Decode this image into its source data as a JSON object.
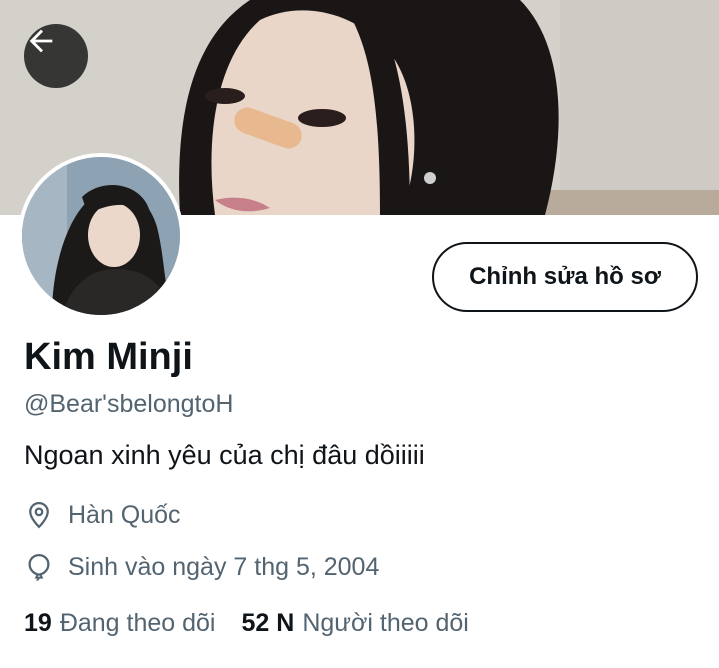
{
  "header": {
    "back_icon": "arrow-left-icon",
    "edit_profile_label": "Chỉnh sửa hồ sơ"
  },
  "profile": {
    "name": "Kim Minji",
    "handle": "@Bear'sbelongtoH",
    "bio": "Ngoan xinh yêu của chị đâu dồiiiii",
    "location": "Hàn Quốc",
    "location_icon": "map-pin-icon",
    "birth": "Sinh vào ngày 7 thg 5, 2004",
    "birth_icon": "balloon-icon"
  },
  "stats": {
    "following_count": "19",
    "following_label": "Đang theo dõi",
    "followers_count": "52 N",
    "followers_label": "Người theo dõi"
  },
  "colors": {
    "text_primary": "#0f1419",
    "text_secondary": "#536471",
    "button_border": "#0f1419",
    "back_button_bg": "#141414"
  }
}
